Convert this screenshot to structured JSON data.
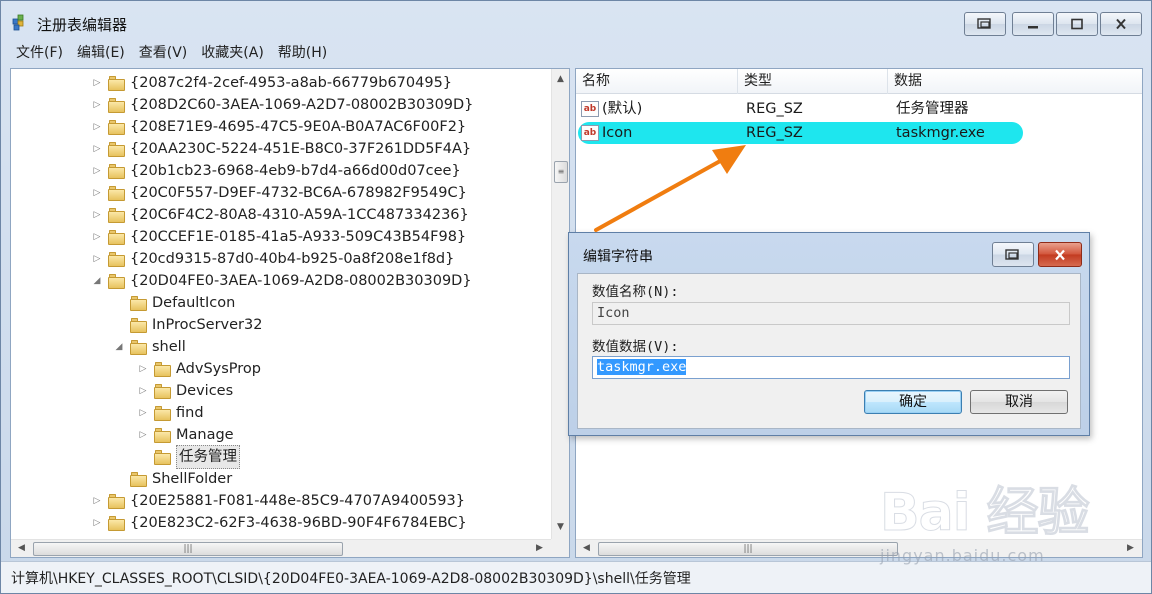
{
  "window": {
    "title": "注册表编辑器"
  },
  "menu": [
    "文件(F)",
    "编辑(E)",
    "查看(V)",
    "收藏夹(A)",
    "帮助(H)"
  ],
  "tree": [
    {
      "label": "{2087c2f4-2cef-4953-a8ab-66779b670495}",
      "expander": "▷"
    },
    {
      "label": "{208D2C60-3AEA-1069-A2D7-08002B30309D}",
      "expander": "▷"
    },
    {
      "label": "{208E71E9-4695-47C5-9E0A-B0A7AC6F00F2}",
      "expander": "▷"
    },
    {
      "label": "{20AA230C-5224-451E-B8C0-37F261DD5F4A}",
      "expander": "▷"
    },
    {
      "label": "{20b1cb23-6968-4eb9-b7d4-a66d00d07cee}",
      "expander": "▷"
    },
    {
      "label": "{20C0F557-D9EF-4732-BC6A-678982F9549C}",
      "expander": "▷"
    },
    {
      "label": "{20C6F4C2-80A8-4310-A59A-1CC487334236}",
      "expander": "▷"
    },
    {
      "label": "{20CCEF1E-0185-41a5-A933-509C43B54F98}",
      "expander": "▷"
    },
    {
      "label": "{20cd9315-87d0-40b4-b925-0a8f208e1f8d}",
      "expander": "▷"
    },
    {
      "label": "{20D04FE0-3AEA-1069-A2D8-08002B30309D}",
      "expander": "◢"
    },
    {
      "label": "DefaultIcon",
      "expander": ""
    },
    {
      "label": "InProcServer32",
      "expander": ""
    },
    {
      "label": "shell",
      "expander": "◢"
    },
    {
      "label": "AdvSysProp",
      "expander": "▷"
    },
    {
      "label": "Devices",
      "expander": "▷"
    },
    {
      "label": "find",
      "expander": "▷"
    },
    {
      "label": "Manage",
      "expander": "▷"
    },
    {
      "label": "任务管理",
      "expander": ""
    },
    {
      "label": "ShellFolder",
      "expander": ""
    },
    {
      "label": "{20E25881-F081-448e-85C9-4707A9400593}",
      "expander": "▷"
    },
    {
      "label": "{20E823C2-62F3-4638-96BD-90F4F6784EBC}",
      "expander": "▷"
    }
  ],
  "list": {
    "headers": [
      "名称",
      "类型",
      "数据"
    ],
    "rows": [
      {
        "name": "(默认)",
        "type": "REG_SZ",
        "data": "任务管理器"
      },
      {
        "name": "Icon",
        "type": "REG_SZ",
        "data": "taskmgr.exe"
      }
    ]
  },
  "status": "计算机\\HKEY_CLASSES_ROOT\\CLSID\\{20D04FE0-3AEA-1069-A2D8-08002B30309D}\\shell\\任务管理",
  "dialog": {
    "title": "编辑字符串",
    "name_label": "数值名称(N):",
    "name_value": "Icon",
    "data_label": "数值数据(V):",
    "data_value": "taskmgr.exe",
    "ok": "确定",
    "cancel": "取消"
  },
  "watermark": {
    "logo": "Bai 经验",
    "url": "jingyan.baidu.com"
  },
  "colors": {
    "highlight": "#1ee6ee",
    "arrow": "#f07d10",
    "selection": "#3399ff"
  }
}
